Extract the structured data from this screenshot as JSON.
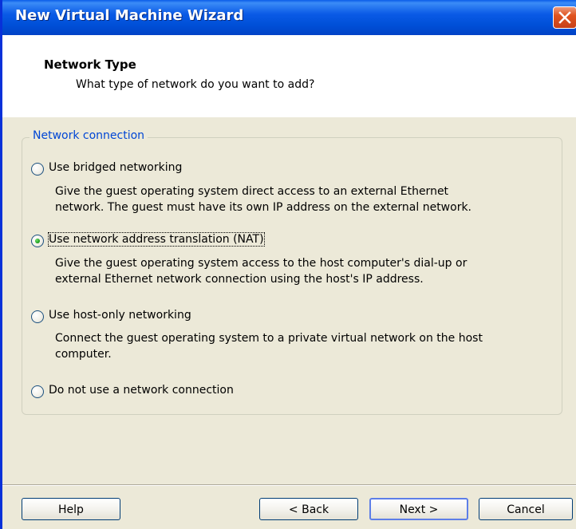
{
  "window": {
    "title": "New Virtual Machine Wizard"
  },
  "header": {
    "title": "Network Type",
    "subtitle": "What type of network do you want to add?"
  },
  "group": {
    "legend": "Network connection"
  },
  "options": [
    {
      "label": "Use bridged networking",
      "description_line1": "Give the guest operating system direct access to an external Ethernet",
      "description_line2": "network. The guest must have its own IP address on the external network.",
      "checked": false
    },
    {
      "label": "Use network address translation (NAT)",
      "description_line1": "Give the guest operating system access to the host computer's dial-up or",
      "description_line2": "external Ethernet network connection using the host's IP address.",
      "checked": true
    },
    {
      "label": "Use host-only networking",
      "description_line1": "Connect the guest operating system to a private virtual network on the host",
      "description_line2": "computer.",
      "checked": false
    },
    {
      "label": "Do not use a network connection",
      "checked": false
    }
  ],
  "buttons": {
    "help": "Help",
    "back": "< Back",
    "next": "Next >",
    "cancel": "Cancel"
  },
  "icons": {
    "close": "close-icon"
  },
  "colors": {
    "title_bar": "#0a5ae6",
    "window_bg": "#ece9d8",
    "group_legend": "#0046d5",
    "close_button": "#e0541f"
  }
}
